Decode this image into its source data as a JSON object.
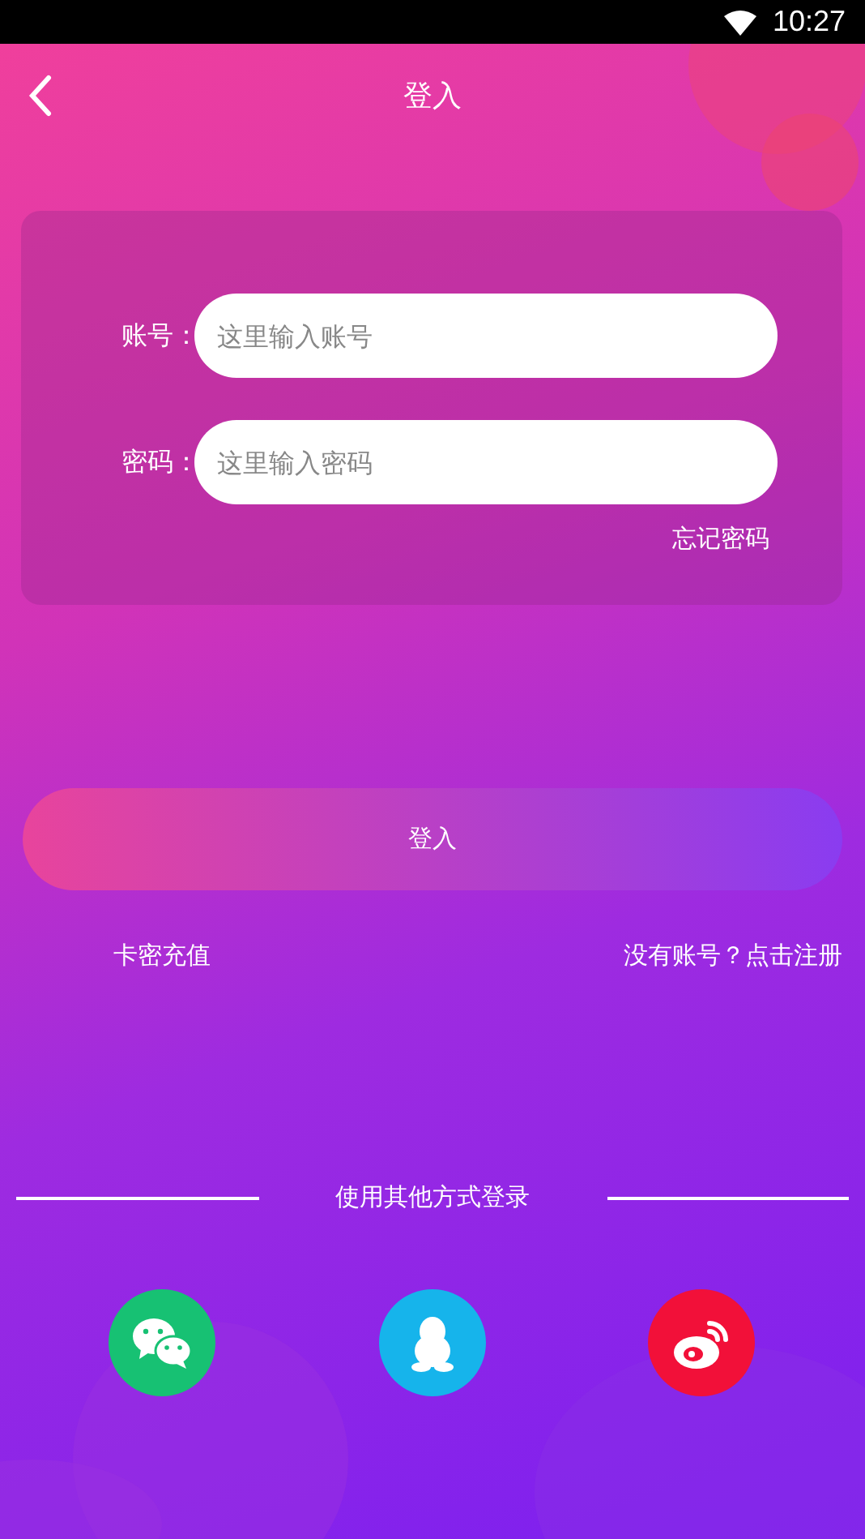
{
  "status_bar": {
    "time": "10:27"
  },
  "header": {
    "title": "登入"
  },
  "form": {
    "fields": [
      {
        "label": "账号：",
        "placeholder": "这里输入账号"
      },
      {
        "label": "密码：",
        "placeholder": "这里输入密码"
      }
    ],
    "forgot_link": "忘记密码"
  },
  "login_button": "登入",
  "links": {
    "left": "卡密充值",
    "right": "没有账号？点击注册"
  },
  "other_login": {
    "label": "使用其他方式登录",
    "options": [
      {
        "kind": "wechat",
        "color": "#17c173"
      },
      {
        "kind": "qq",
        "color": "#16b4eb"
      },
      {
        "kind": "weibo",
        "color": "#f21039"
      }
    ]
  }
}
